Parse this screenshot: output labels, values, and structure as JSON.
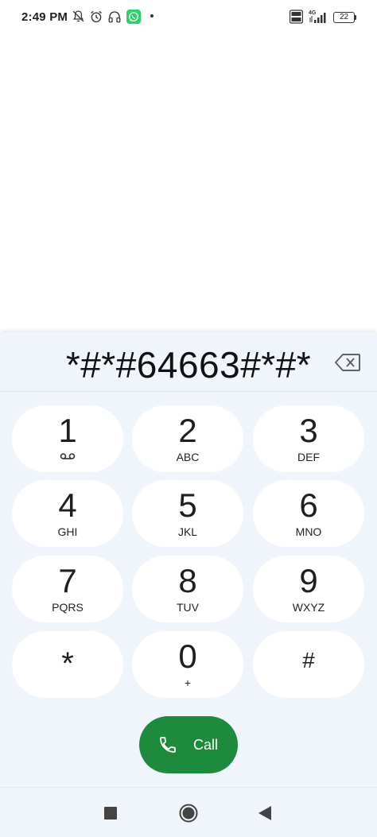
{
  "status_bar": {
    "time": "2:49 PM",
    "network_type": "4G",
    "battery_level": "22",
    "icons": [
      "bell-off-icon",
      "alarm-icon",
      "headphones-icon",
      "whatsapp-icon",
      "volte-icon",
      "signal-icon",
      "battery-icon"
    ]
  },
  "dialer": {
    "entered_number": "*#*#64663#*#*",
    "keys": [
      {
        "digit": "1",
        "letters": "",
        "icon": "voicemail-icon"
      },
      {
        "digit": "2",
        "letters": "ABC"
      },
      {
        "digit": "3",
        "letters": "DEF"
      },
      {
        "digit": "4",
        "letters": "GHI"
      },
      {
        "digit": "5",
        "letters": "JKL"
      },
      {
        "digit": "6",
        "letters": "MNO"
      },
      {
        "digit": "7",
        "letters": "PQRS"
      },
      {
        "digit": "8",
        "letters": "TUV"
      },
      {
        "digit": "9",
        "letters": "WXYZ"
      },
      {
        "digit": "*",
        "letters": ""
      },
      {
        "digit": "0",
        "letters": "+"
      },
      {
        "digit": "#",
        "letters": ""
      }
    ],
    "call_label": "Call"
  },
  "colors": {
    "panel_bg": "#f0f4fb",
    "key_bg": "#ffffff",
    "call_green": "#1e8a3e",
    "whatsapp_green": "#25d366"
  }
}
